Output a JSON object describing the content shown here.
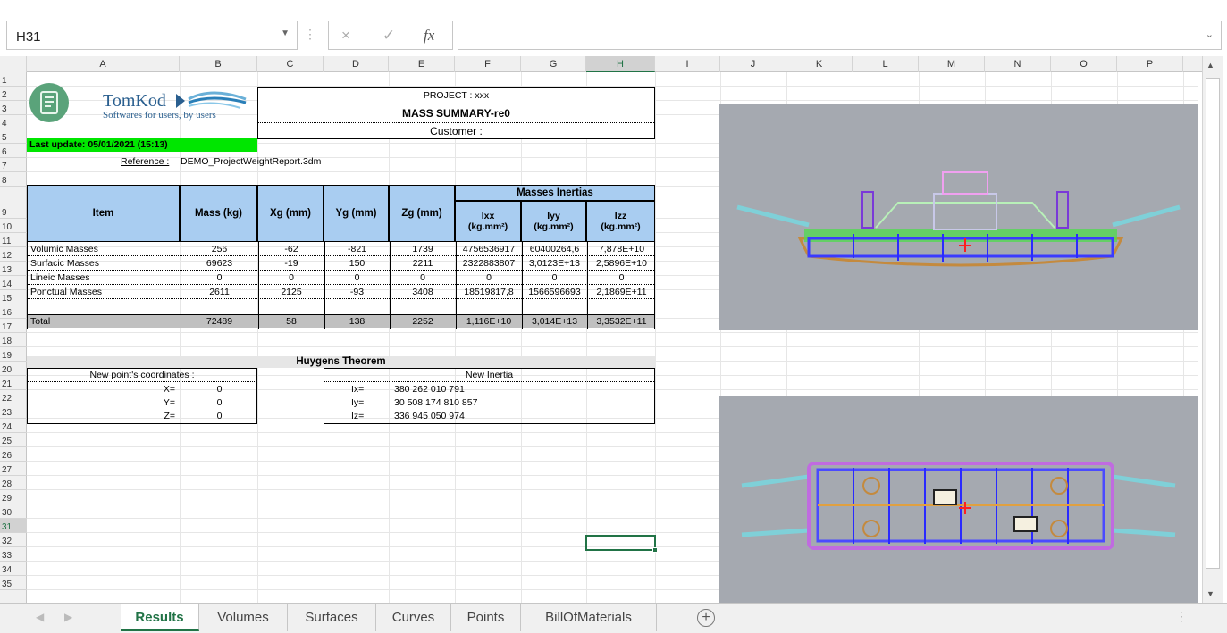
{
  "namebox": {
    "value": "H31",
    "dropdown_icon": "chevron-down-icon"
  },
  "formula": {
    "cancel_icon": "×",
    "enter_icon": "✓",
    "fx_label": "fx",
    "value": ""
  },
  "columns": [
    "A",
    "B",
    "C",
    "D",
    "E",
    "F",
    "G",
    "H",
    "I",
    "J",
    "K",
    "L",
    "M",
    "N",
    "O",
    "P"
  ],
  "selected_column": "H",
  "selected_row": "31",
  "rows": [
    "1",
    "2",
    "3",
    "4",
    "5",
    "6",
    "7",
    "8",
    "9",
    "10",
    "11",
    "12",
    "13",
    "14",
    "15",
    "16",
    "17",
    "18",
    "19",
    "20",
    "21",
    "22",
    "23",
    "24",
    "25",
    "26",
    "27",
    "28",
    "29",
    "30",
    "31",
    "32",
    "33",
    "34",
    "35"
  ],
  "logo": {
    "name": "TomKod",
    "tagline": "Softwares for users, by users"
  },
  "project": {
    "line1": "PROJECT : xxx",
    "line2": "MASS SUMMARY-re0",
    "line3": "Customer :"
  },
  "last_update": "Last update:  05/01/2021 (15:13)",
  "reference": {
    "label": "Reference :",
    "value": "DEMO_ProjectWeightReport.3dm"
  },
  "table": {
    "group_header": "Masses Inertias",
    "headers": [
      "Item",
      "Mass (kg)",
      "Xg (mm)",
      "Yg (mm)",
      "Zg (mm)",
      "Ixx\n(kg.mm²)",
      "Iyy\n(kg.mm²)",
      "Izz\n(kg.mm²)"
    ],
    "rows": [
      [
        "Volumic Masses",
        "256",
        "-62",
        "-821",
        "1739",
        "4756536917",
        "60400264,6",
        "7,878E+10"
      ],
      [
        "Surfacic Masses",
        "69623",
        "-19",
        "150",
        "2211",
        "2322883807",
        "3,0123E+13",
        "2,5896E+10"
      ],
      [
        "Lineic Masses",
        "0",
        "0",
        "0",
        "0",
        "0",
        "0",
        "0"
      ],
      [
        "Ponctual Masses",
        "2611",
        "2125",
        "-93",
        "3408",
        "18519817,8",
        "1566596693",
        "2,1869E+11"
      ]
    ],
    "total": [
      "Total",
      "72489",
      "58",
      "138",
      "2252",
      "1,116E+10",
      "3,014E+13",
      "3,3532E+11"
    ]
  },
  "huygens": {
    "title": "Huygens Theorem",
    "coords_title": "New point's coordinates :",
    "coords": [
      {
        "label": "X=",
        "value": "0"
      },
      {
        "label": "Y=",
        "value": "0"
      },
      {
        "label": "Z=",
        "value": "0"
      }
    ],
    "inertia_title": "New Inertia",
    "inertia": [
      {
        "label": "Ix=",
        "value": "380 262 010 791"
      },
      {
        "label": "Iy=",
        "value": "30 508 174 810 857"
      },
      {
        "label": "Iz=",
        "value": "336 945 050 974"
      }
    ]
  },
  "tabs": [
    "Results",
    "Volumes",
    "Surfaces",
    "Curves",
    "Points",
    "BillOfMaterials"
  ],
  "active_tab": "Results",
  "add_sheet_label": "+",
  "colors": {
    "header_blue": "#a9cdf1",
    "last_update_green": "#00e600",
    "total_gray": "#c0c0c0",
    "excel_green": "#217346"
  }
}
